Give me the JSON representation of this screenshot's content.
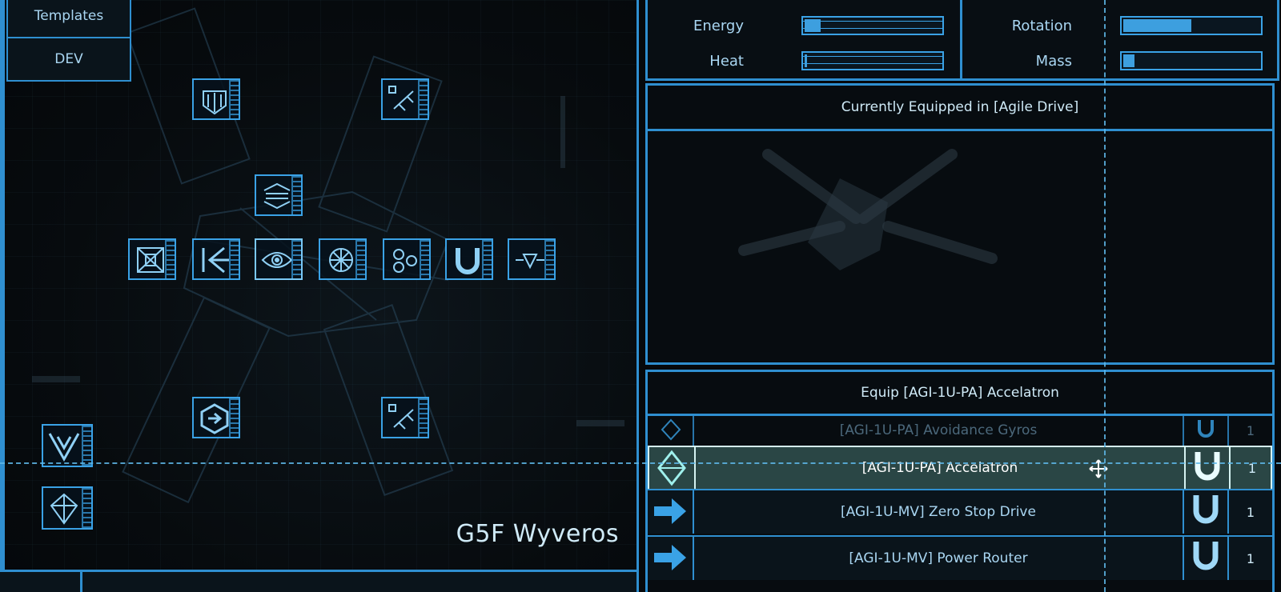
{
  "menu": {
    "templates_label": "Templates",
    "dev_label": "DEV"
  },
  "ship": {
    "name": "G5F Wyveros"
  },
  "stats": {
    "energy_label": "Energy",
    "heat_label": "Heat",
    "rotation_label": "Rotation",
    "mass_label": "Mass",
    "energy_level": 0.12,
    "heat_level": 0.02,
    "rotation_level": 0.5,
    "mass_level": 0.08
  },
  "equipped": {
    "title": "Currently Equipped in [Agile Drive]"
  },
  "equip": {
    "title": "Equip [AGI-1U-PA] Accelatron",
    "items": [
      {
        "name": "[AGI-1U-PA] Avoidance Gyros",
        "qty": "1",
        "icon": "diamond-icon",
        "type_icon": "magnet-u-icon"
      },
      {
        "name": "[AGI-1U-PA] Accelatron",
        "qty": "1",
        "icon": "diamond-icon",
        "type_icon": "magnet-u-icon"
      },
      {
        "name": "[AGI-1U-MV] Zero Stop Drive",
        "qty": "1",
        "icon": "arrow-right-icon",
        "type_icon": "magnet-u-icon"
      },
      {
        "name": "[AGI-1U-MV] Power Router",
        "qty": "1",
        "icon": "arrow-right-icon",
        "type_icon": "magnet-u-icon"
      }
    ]
  },
  "colors": {
    "accent": "#2f8fd0",
    "highlight": "#3aa2e6",
    "selected_row": "#6eb4aa"
  }
}
